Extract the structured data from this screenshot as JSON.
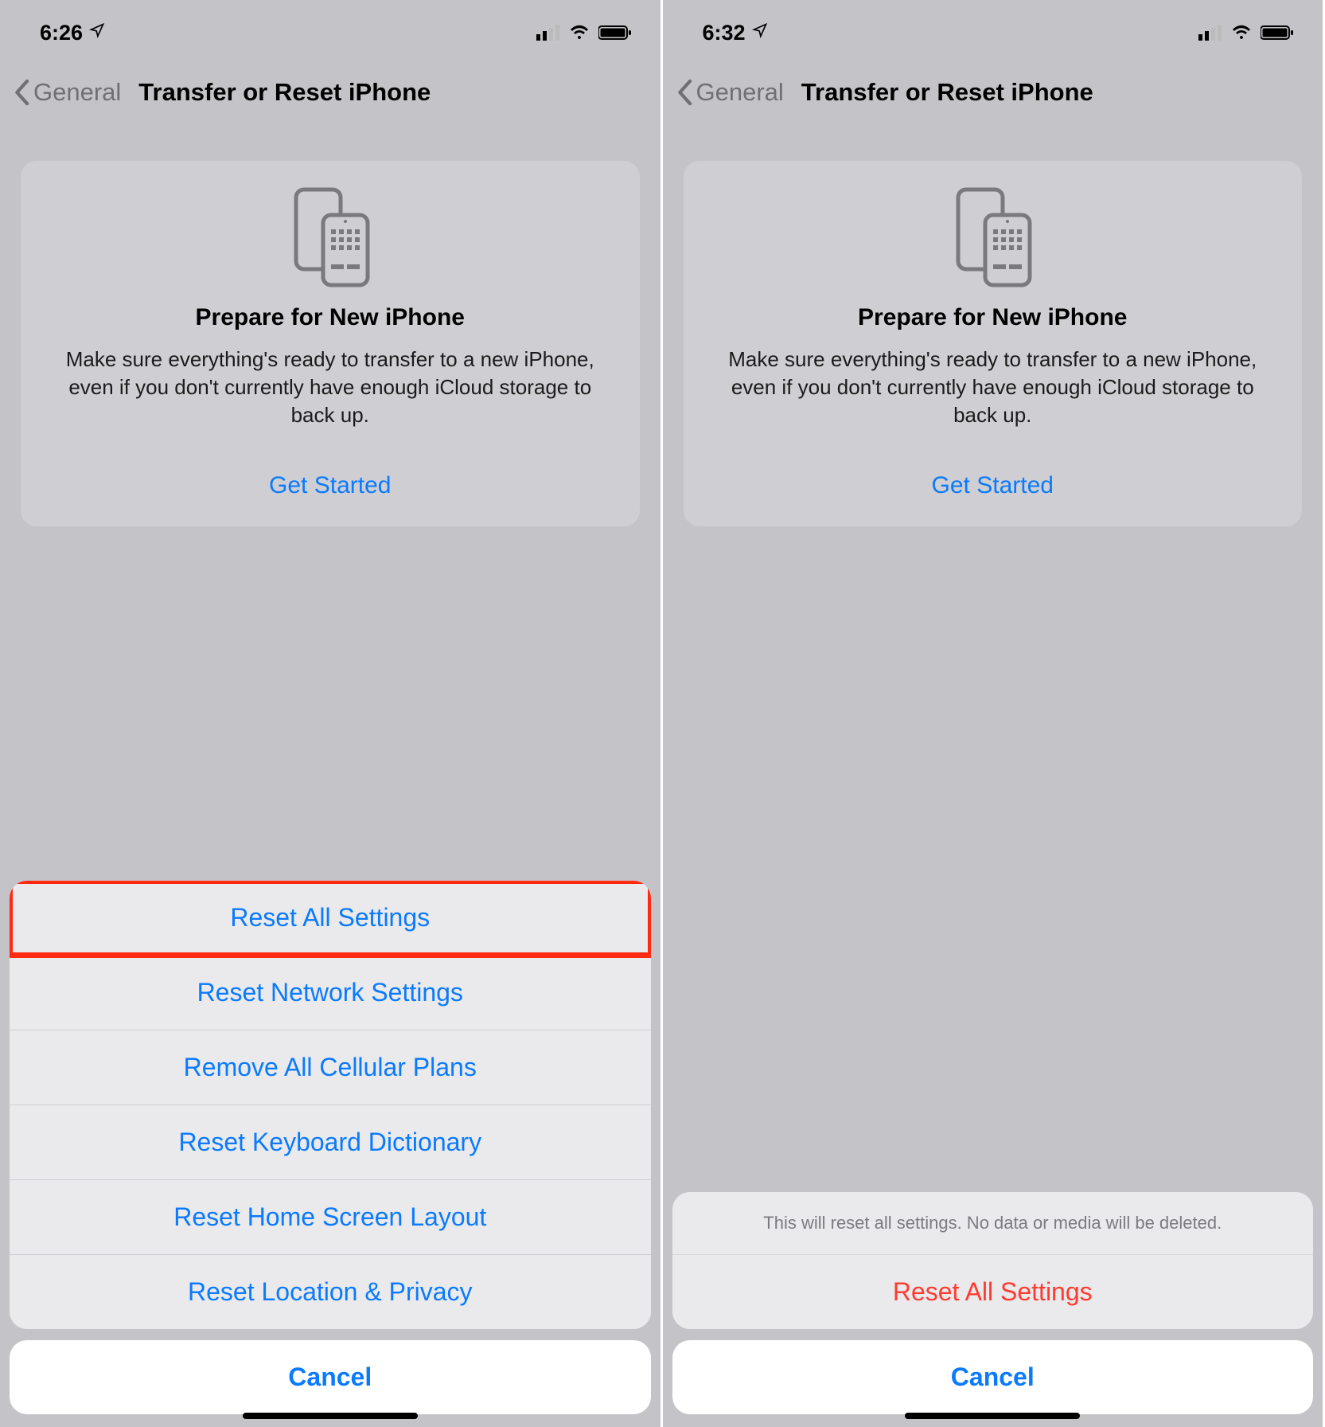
{
  "left": {
    "status_time": "6:26",
    "nav_back": "General",
    "nav_title": "Transfer or Reset iPhone",
    "card": {
      "title": "Prepare for New iPhone",
      "desc": "Make sure everything's ready to transfer to a new iPhone, even if you don't currently have enough iCloud storage to back up.",
      "cta": "Get Started"
    },
    "sheet": {
      "items": [
        "Reset All Settings",
        "Reset Network Settings",
        "Remove All Cellular Plans",
        "Reset Keyboard Dictionary",
        "Reset Home Screen Layout",
        "Reset Location & Privacy"
      ],
      "cancel": "Cancel"
    }
  },
  "right": {
    "status_time": "6:32",
    "nav_back": "General",
    "nav_title": "Transfer or Reset iPhone",
    "card": {
      "title": "Prepare for New iPhone",
      "desc": "Make sure everything's ready to transfer to a new iPhone, even if you don't currently have enough iCloud storage to back up.",
      "cta": "Get Started"
    },
    "confirm": {
      "header": "This will reset all settings. No data or media will be deleted.",
      "action": "Reset All Settings",
      "cancel": "Cancel"
    }
  }
}
